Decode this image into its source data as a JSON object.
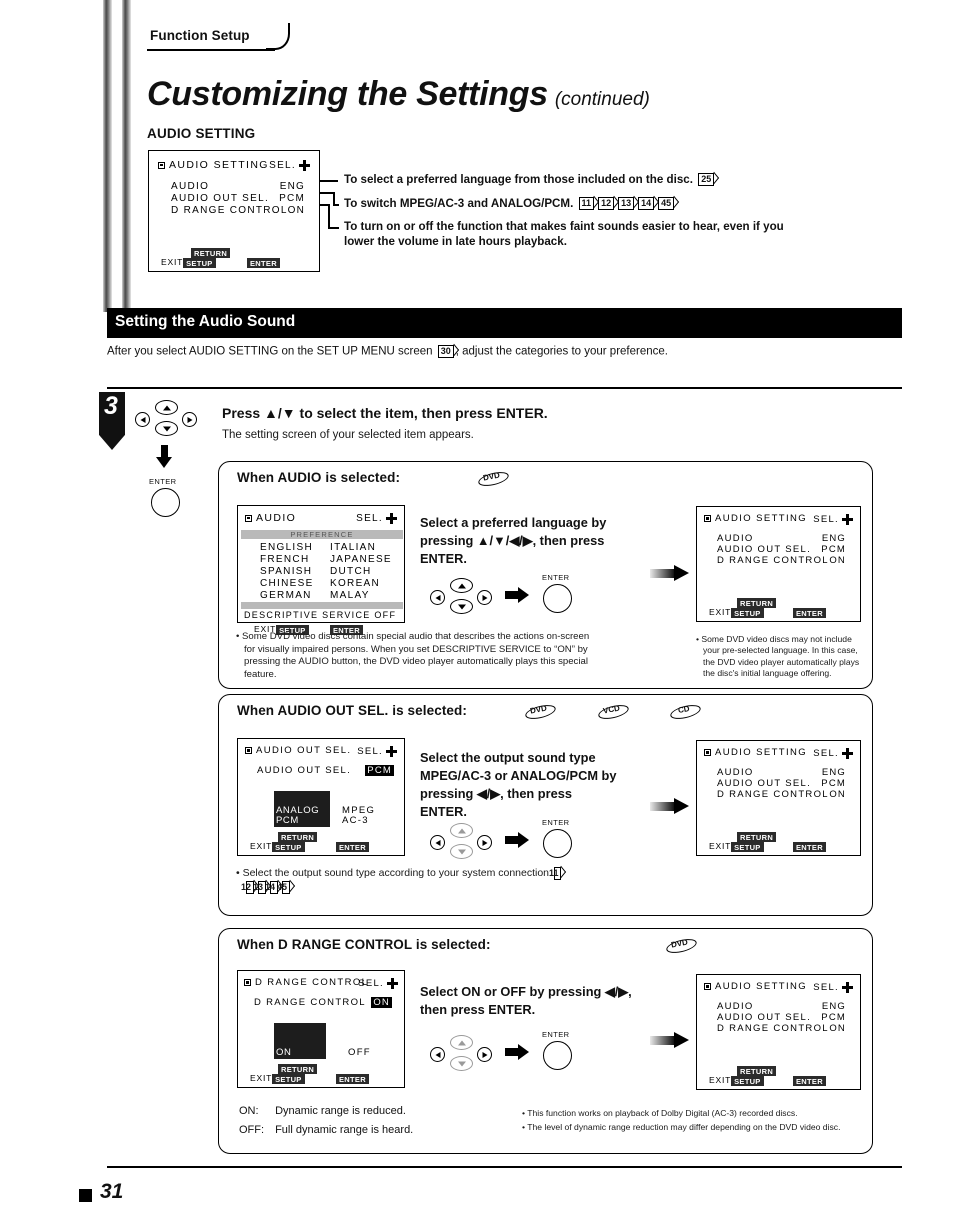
{
  "page": {
    "tab_label": "Function Setup",
    "title": "Customizing the Settings",
    "title_continued": "(continued)",
    "subhead": "AUDIO SETTING",
    "page_number": "31"
  },
  "osd_top": {
    "title": "AUDIO SETTING",
    "sel_label": "SEL.",
    "rows": [
      {
        "label": "AUDIO",
        "value": "ENG"
      },
      {
        "label": "AUDIO OUT SEL.",
        "value": "PCM"
      },
      {
        "label": "D RANGE CONTROL",
        "value": "ON"
      }
    ],
    "return_chip": "RETURN",
    "exit_label": "EXIT",
    "setup_chip": "SETUP",
    "enter_chip": "ENTER"
  },
  "callouts": [
    {
      "text": "To select a preferred language from those included on the disc.",
      "refs": [
        "25"
      ]
    },
    {
      "text": "To switch MPEG/AC-3 and ANALOG/PCM.",
      "refs": [
        "11",
        "12",
        "13",
        "14",
        "45"
      ]
    },
    {
      "text": "To turn on or off the function that makes faint sounds easier to hear, even if you lower the volume in late hours playback.",
      "refs": []
    }
  ],
  "section": {
    "heading": "Setting the Audio Sound",
    "intro_before": "After you select AUDIO SETTING on the SET UP MENU screen",
    "intro_ref": "30",
    "intro_after": ", adjust the categories to your preference."
  },
  "step": {
    "number": "3",
    "heading": "Press ▲/▼ to select the item, then press ENTER.",
    "body": "The setting screen of your selected item appears.",
    "enter_cap": "ENTER"
  },
  "block_audio": {
    "title": "When AUDIO is selected:",
    "discs": [
      "DVD"
    ],
    "osd": {
      "title": "AUDIO",
      "sel_label": "SEL.",
      "preference_bar": "PREFERENCE",
      "languages_left": [
        "ENGLISH",
        "FRENCH",
        "SPANISH",
        "CHINESE",
        "GERMAN"
      ],
      "languages_right": [
        "ITALIAN",
        "JAPANESE",
        "DUTCH",
        "KOREAN",
        "MALAY"
      ],
      "descriptive_label": "DESCRIPTIVE SERVICE",
      "descriptive_value": "OFF",
      "exit_label": "EXIT",
      "setup_chip": "SETUP",
      "enter_chip": "ENTER"
    },
    "instruction": "Select a preferred language by pressing ▲/▼/◀/▶, then press ENTER.",
    "enter_cap": "ENTER",
    "note": "Some DVD video discs contain special audio that describes the actions on-screen for visually impaired persons.  When you set DESCRIPTIVE SERVICE to “ON” by pressing the AUDIO button, the DVD video player automatically plays this special feature.",
    "result_note": "Some DVD video discs may not include your pre-selected language. In this case, the DVD video player automatically plays the disc's initial language offering.",
    "result_osd": {
      "title": "AUDIO SETTING",
      "sel_label": "SEL.",
      "rows": [
        {
          "label": "AUDIO",
          "value": "ENG"
        },
        {
          "label": "AUDIO OUT SEL.",
          "value": "PCM"
        },
        {
          "label": "D RANGE CONTROL",
          "value": "ON"
        }
      ],
      "return_chip": "RETURN",
      "exit_label": "EXIT",
      "setup_chip": "SETUP",
      "enter_chip": "ENTER"
    }
  },
  "block_audio_out": {
    "title": "When AUDIO OUT SEL. is selected:",
    "discs": [
      "DVD",
      "VCD",
      "CD"
    ],
    "osd": {
      "title": "AUDIO OUT SEL.",
      "sel_label": "SEL.",
      "row_label": "AUDIO OUT SEL.",
      "row_value": "PCM",
      "option_selected_line1": "ANALOG",
      "option_selected_line2": "PCM",
      "option_other_line1": "MPEG",
      "option_other_line2": "AC-3",
      "return_chip": "RETURN",
      "exit_label": "EXIT",
      "setup_chip": "SETUP",
      "enter_chip": "ENTER"
    },
    "instruction": "Select the output sound type MPEG/AC-3 or ANALOG/PCM by pressing ◀/▶, then press ENTER.",
    "enter_cap": "ENTER",
    "note": "Select the output sound type according to your system connection.",
    "note_refs": [
      "11",
      "12",
      "13",
      "14",
      "45"
    ],
    "result_osd": {
      "title": "AUDIO SETTING",
      "sel_label": "SEL.",
      "rows": [
        {
          "label": "AUDIO",
          "value": "ENG"
        },
        {
          "label": "AUDIO OUT SEL.",
          "value": "PCM"
        },
        {
          "label": "D RANGE CONTROL",
          "value": "ON"
        }
      ],
      "return_chip": "RETURN",
      "exit_label": "EXIT",
      "setup_chip": "SETUP",
      "enter_chip": "ENTER"
    }
  },
  "block_drange": {
    "title": "When D RANGE CONTROL is selected:",
    "discs": [
      "DVD"
    ],
    "osd": {
      "title": "D RANGE CONTROL",
      "sel_label": "SEL.",
      "row_label": "D RANGE CONTROL",
      "row_value": "ON",
      "option_selected": "ON",
      "option_other": "OFF",
      "return_chip": "RETURN",
      "exit_label": "EXIT",
      "setup_chip": "SETUP",
      "enter_chip": "ENTER"
    },
    "instruction": "Select ON or OFF by pressing ◀/▶, then press ENTER.",
    "enter_cap": "ENTER",
    "legend": [
      {
        "key": "ON:",
        "text": "Dynamic range is reduced."
      },
      {
        "key": "OFF:",
        "text": "Full dynamic range is heard."
      }
    ],
    "notes": [
      "This function works on playback of Dolby Digital (AC-3) recorded discs.",
      "The level of dynamic range reduction may differ depending on the DVD video disc."
    ],
    "result_osd": {
      "title": "AUDIO SETTING",
      "sel_label": "SEL.",
      "rows": [
        {
          "label": "AUDIO",
          "value": "ENG"
        },
        {
          "label": "AUDIO OUT SEL.",
          "value": "PCM"
        },
        {
          "label": "D RANGE CONTROL",
          "value": "ON"
        }
      ],
      "return_chip": "RETURN",
      "exit_label": "EXIT",
      "setup_chip": "SETUP",
      "enter_chip": "ENTER"
    }
  }
}
